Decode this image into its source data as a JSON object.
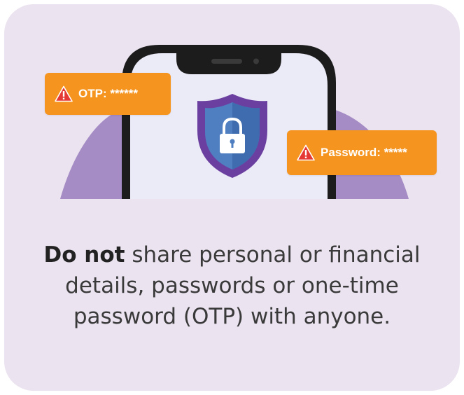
{
  "colors": {
    "card_background": "#ebe3f0",
    "blob": "#a58cc4",
    "phone_frame": "#1c1c1c",
    "phone_screen": "#ebeaf7",
    "shield_outer": "#6b3fa0",
    "shield_inner": "#4f7fc1",
    "badge_background": "#f5941e",
    "warning_red": "#e53935"
  },
  "icons": {
    "shield": "shield-lock-icon",
    "warning": "warning-triangle-icon"
  },
  "badges": {
    "otp_label": "OTP: ******",
    "password_label": "Password: *****"
  },
  "message": {
    "bold": "Do not",
    "line1_rest": " share personal or financial",
    "line2": "details, passwords or one-time",
    "line3": "password (OTP) with anyone."
  }
}
